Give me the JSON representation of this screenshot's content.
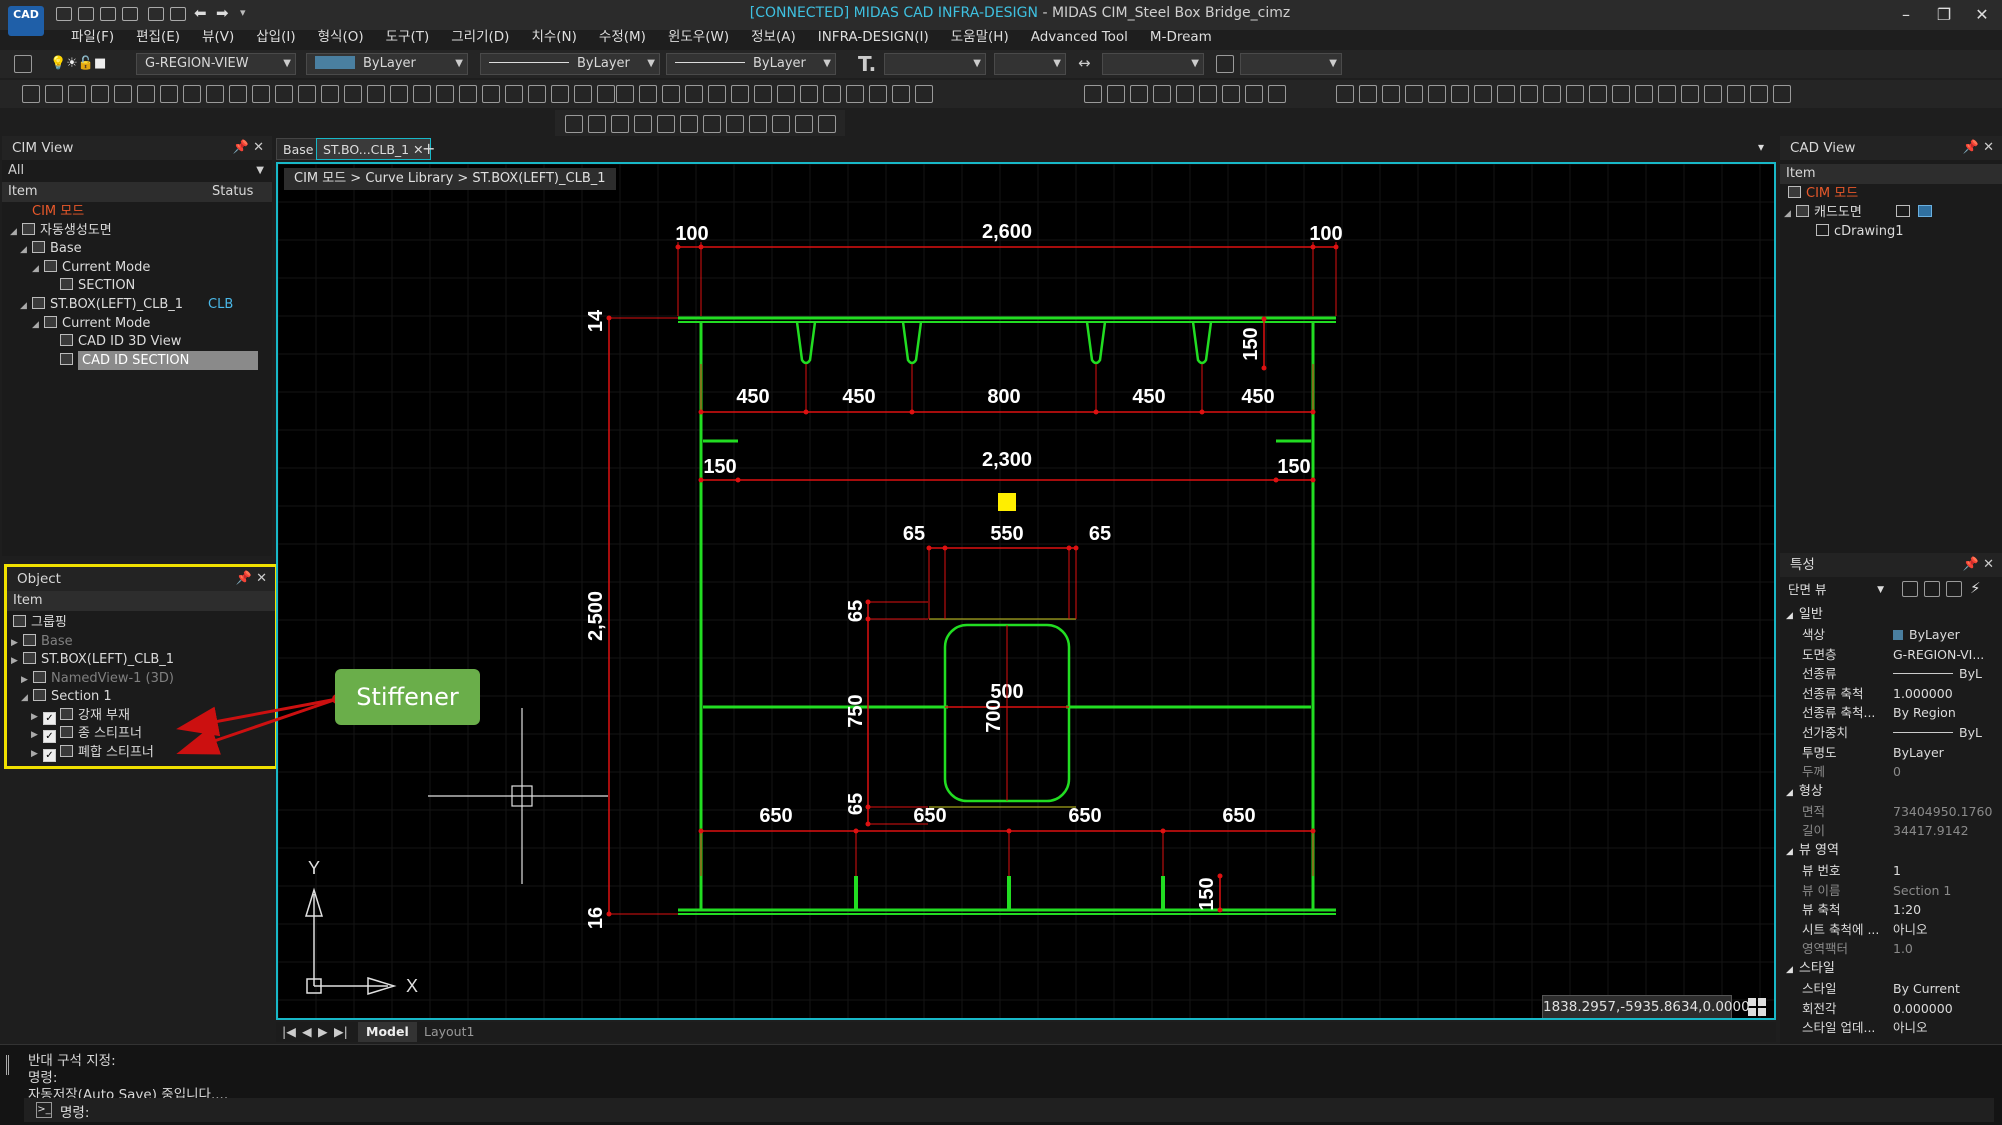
{
  "window": {
    "title_connected": "[CONNECTED] MIDAS CAD INFRA-DESIGN",
    "title_rest": " - MIDAS CIM_Steel Box Bridge_cimz",
    "logo": "CAD",
    "minimize": "–",
    "restore": "❐",
    "close": "✕"
  },
  "menu": [
    "파일(F)",
    "편집(E)",
    "뷰(V)",
    "삽입(I)",
    "형식(O)",
    "도구(T)",
    "그리기(D)",
    "치수(N)",
    "수정(M)",
    "윈도우(W)",
    "정보(A)",
    "INFRA-DESIGN(I)",
    "도움말(H)",
    "Advanced Tool",
    "M-Dream"
  ],
  "toolbar": {
    "layer": "G-REGION-VIEW",
    "color": "ByLayer",
    "linetype": "ByLayer",
    "lineweight": "ByLayer"
  },
  "cim_view": {
    "title": "CIM View",
    "filter": "All",
    "col_item": "Item",
    "col_status": "Status",
    "items": [
      {
        "label": "CIM 모드"
      },
      {
        "label": "자동생성도면"
      },
      {
        "label": "Base"
      },
      {
        "label": "Current Mode"
      },
      {
        "label": "SECTION"
      },
      {
        "label": "ST.BOX(LEFT)_CLB_1",
        "status": "CLB"
      },
      {
        "label": "Current Mode"
      },
      {
        "label": "CAD ID 3D View"
      },
      {
        "label": "CAD ID SECTION"
      }
    ]
  },
  "object_panel": {
    "title": "Object",
    "col_item": "Item",
    "items": [
      {
        "label": "그룹핑"
      },
      {
        "label": "Base"
      },
      {
        "label": "ST.BOX(LEFT)_CLB_1"
      },
      {
        "label": "NamedView-1 (3D)"
      },
      {
        "label": "Section 1"
      },
      {
        "label": "강재 부재"
      },
      {
        "label": "종 스티프너"
      },
      {
        "label": "폐합 스티프너"
      }
    ]
  },
  "annotation": {
    "label": "Stiffener",
    "color": "#6aae4a",
    "arrow_color": "#cc1010"
  },
  "doc_tabs": [
    "Base",
    "ST.BO...CLB_1"
  ],
  "breadcrumb": "CIM 모드 > Curve Library > ST.BOX(LEFT)_CLB_1",
  "drawing": {
    "dims_top": [
      "100",
      "2,600",
      "100"
    ],
    "dim_top_thickness": "14",
    "dim_rib_height": "150",
    "rib_spacing": [
      "450",
      "450",
      "800",
      "450",
      "450"
    ],
    "web_stiff": [
      "150",
      "2,300",
      "150"
    ],
    "opening_top": [
      "65",
      "550",
      "65"
    ],
    "total_height": "2,500",
    "opening_side": [
      "65",
      "750",
      "65"
    ],
    "opening_w": "500",
    "opening_h": "700",
    "bottom_spacing": [
      "650",
      "650",
      "650",
      "650"
    ],
    "bottom_rib_height": "150",
    "dim_bottom_thickness": "16",
    "axis_x": "X",
    "axis_y": "Y",
    "line_color": "#22dd22",
    "dim_color": "#dd1111"
  },
  "coords": "1838.2957,-5935.8634,0.0000",
  "layout_tabs": [
    "Model",
    "Layout1"
  ],
  "cad_view": {
    "title": "CAD View",
    "col_item": "Item",
    "items": [
      {
        "label": "CIM 모드"
      },
      {
        "label": "캐드도면"
      },
      {
        "label": "cDrawing1"
      }
    ]
  },
  "properties": {
    "title": "특성",
    "selector": "단면 뷰",
    "categories": {
      "general": "일반",
      "geometry": "형상",
      "view_area": "뷰 영역",
      "style": "스타일"
    },
    "general": [
      {
        "k": "색상",
        "v": "ByLayer"
      },
      {
        "k": "도면층",
        "v": "G-REGION-VI..."
      },
      {
        "k": "선종류",
        "v": "ByL"
      },
      {
        "k": "선종류 축척",
        "v": "1.000000"
      },
      {
        "k": "선종류 축척...",
        "v": "By Region"
      },
      {
        "k": "선가중치",
        "v": "ByL"
      },
      {
        "k": "투명도",
        "v": "ByLayer"
      },
      {
        "k": "두께",
        "v": "0"
      }
    ],
    "geometry": [
      {
        "k": "면적",
        "v": "73404950.1760"
      },
      {
        "k": "길이",
        "v": "34417.9142"
      }
    ],
    "view_area": [
      {
        "k": "뷰 번호",
        "v": "1"
      },
      {
        "k": "뷰 이름",
        "v": "Section 1"
      },
      {
        "k": "뷰 축척",
        "v": "1:20"
      },
      {
        "k": "시트 축척에 ...",
        "v": "아니오"
      },
      {
        "k": "영역팩터",
        "v": "1.0"
      }
    ],
    "style": [
      {
        "k": "스타일",
        "v": "By Current"
      },
      {
        "k": "회전각",
        "v": "0.000000"
      },
      {
        "k": "스타일 업데...",
        "v": "아니오"
      }
    ]
  },
  "command": {
    "line1": "반대 구석 지정:",
    "line2": "명령:",
    "line3": "자동저장(Auto Save) 중입니다....",
    "prompt": "명령:"
  }
}
